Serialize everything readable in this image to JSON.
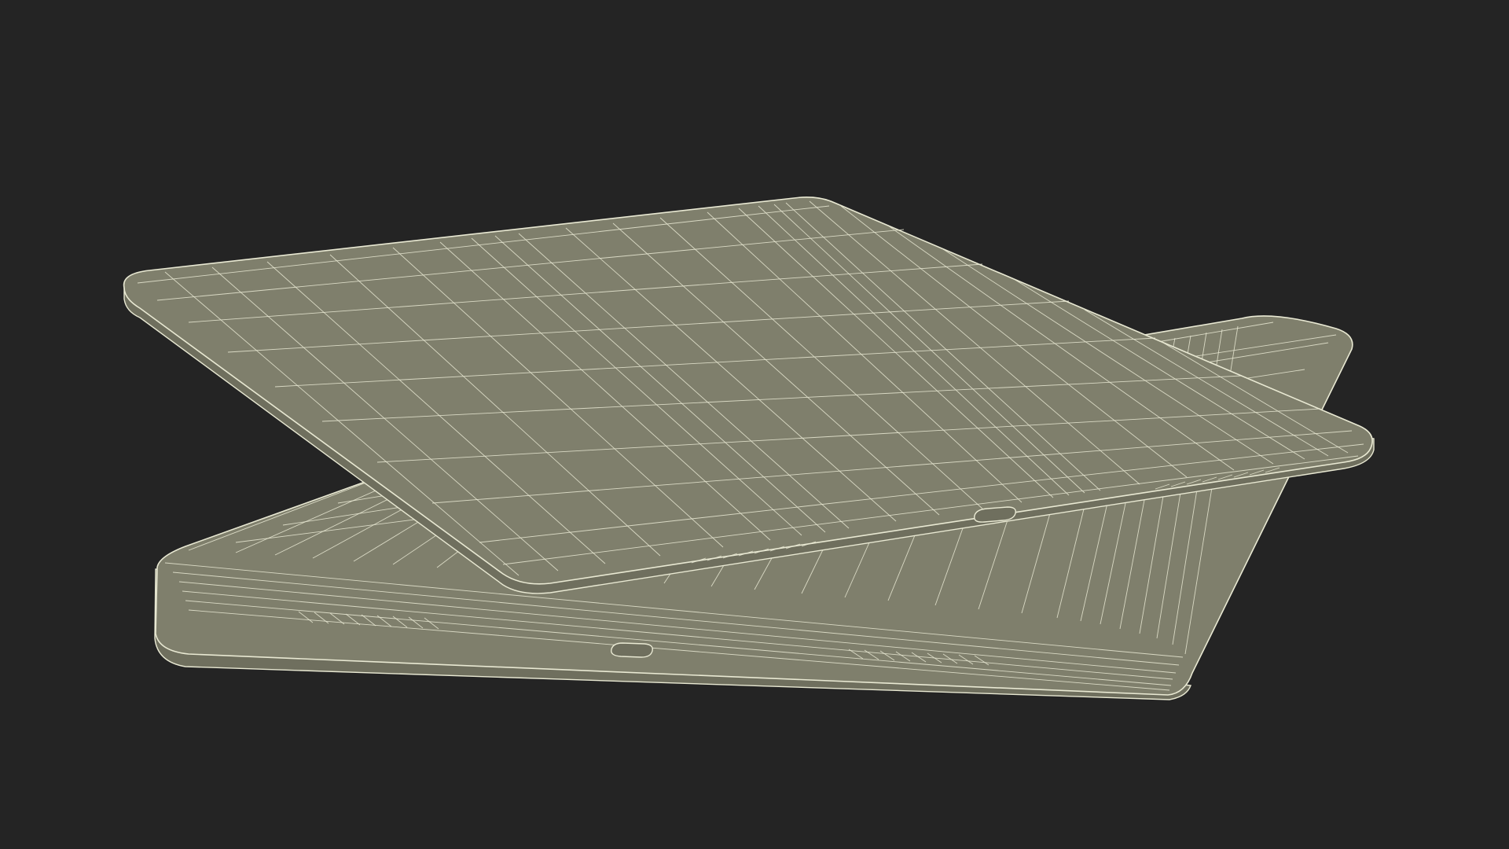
{
  "scene": {
    "subject": "wireframe-tablets",
    "tablet_count": 2,
    "colors": {
      "background": "#242424",
      "surface": "#7f7f6c",
      "surface_shade": "#6f6f5e",
      "wire": "#e9e9d3",
      "shadow": "#161616"
    }
  }
}
